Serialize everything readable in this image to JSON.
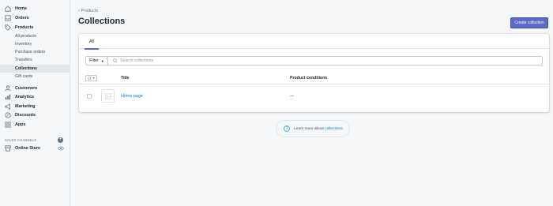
{
  "sidebar": {
    "items": [
      {
        "label": "Home",
        "icon": "home-icon"
      },
      {
        "label": "Orders",
        "icon": "orders-icon"
      },
      {
        "label": "Products",
        "icon": "tag-icon"
      },
      {
        "label": "Customers",
        "icon": "person-icon"
      },
      {
        "label": "Analytics",
        "icon": "bar-chart-icon"
      },
      {
        "label": "Marketing",
        "icon": "megaphone-icon"
      },
      {
        "label": "Discounts",
        "icon": "discount-icon"
      },
      {
        "label": "Apps",
        "icon": "apps-icon"
      }
    ],
    "product_subitems": [
      "All products",
      "Inventory",
      "Purchase orders",
      "Transfers",
      "Collections",
      "Gift cards"
    ],
    "active_subitem": "Collections",
    "sales_channels_heading": "SALES CHANNELS",
    "online_store_label": "Online Store"
  },
  "header": {
    "breadcrumb": "Products",
    "title": "Collections",
    "create_button": "Create collection"
  },
  "tabs": [
    {
      "label": "All",
      "selected": true
    }
  ],
  "filter": {
    "button_label": "Filter",
    "search_placeholder": "Search collections",
    "search_value": ""
  },
  "table": {
    "columns": [
      "Title",
      "Product conditions"
    ],
    "rows": [
      {
        "title": "Home page",
        "conditions": "—"
      }
    ]
  },
  "footer_help": {
    "text": "Learn more about",
    "link": "collections",
    "suffix": "."
  },
  "colors": {
    "accent": "#5c6ac4",
    "link": "#007ace",
    "background": "#f4f6f8"
  }
}
